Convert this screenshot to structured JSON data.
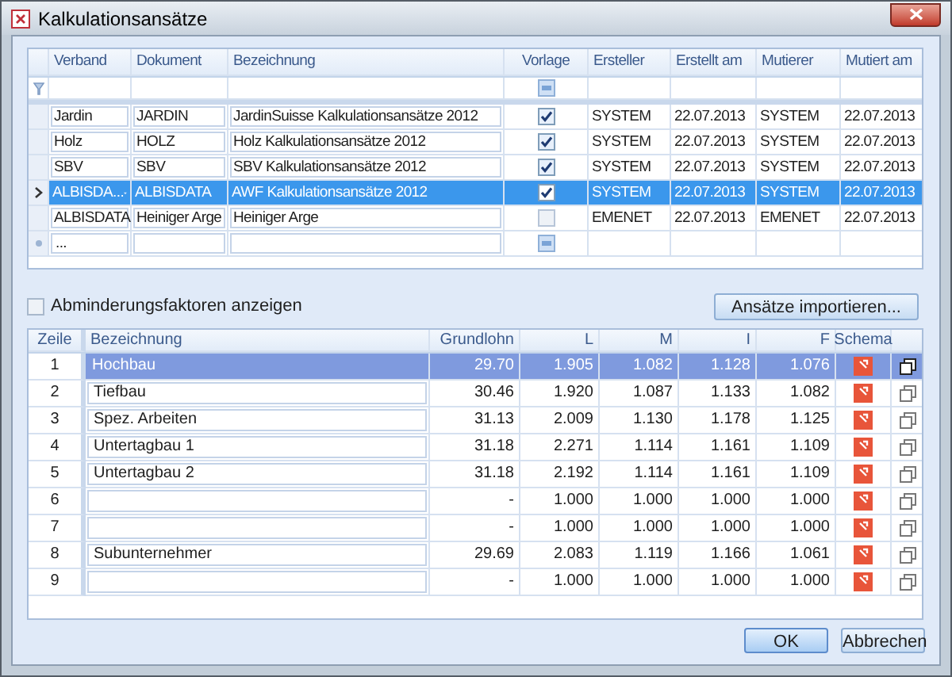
{
  "window": {
    "title": "Kalkulationsansätze"
  },
  "top_grid": {
    "columns": [
      "Verband",
      "Dokument",
      "Bezeichnung",
      "Vorlage",
      "Ersteller",
      "Erstellt am",
      "Mutierer",
      "Mutiert am"
    ],
    "rows": [
      {
        "verband": "Jardin",
        "dokument": "JARDIN",
        "bezeichnung": "JardinSuisse Kalkulationsansätze 2012",
        "vorlage": true,
        "ersteller": "SYSTEM",
        "erstellt_am": "22.07.2013",
        "mutierer": "SYSTEM",
        "mutiert_am": "22.07.2013",
        "selected": false
      },
      {
        "verband": "Holz",
        "dokument": "HOLZ",
        "bezeichnung": "Holz Kalkulationsansätze 2012",
        "vorlage": true,
        "ersteller": "SYSTEM",
        "erstellt_am": "22.07.2013",
        "mutierer": "SYSTEM",
        "mutiert_am": "22.07.2013",
        "selected": false
      },
      {
        "verband": "SBV",
        "dokument": "SBV",
        "bezeichnung": "SBV Kalkulationsansätze 2012",
        "vorlage": true,
        "ersteller": "SYSTEM",
        "erstellt_am": "22.07.2013",
        "mutierer": "SYSTEM",
        "mutiert_am": "22.07.2013",
        "selected": false
      },
      {
        "verband": "ALBISDA...",
        "dokument": "ALBISDATA",
        "bezeichnung": "AWF Kalkulationsansätze 2012",
        "vorlage": true,
        "ersteller": "SYSTEM",
        "erstellt_am": "22.07.2013",
        "mutierer": "SYSTEM",
        "mutiert_am": "22.07.2013",
        "selected": true
      },
      {
        "verband": "ALBISDATA",
        "dokument": "Heiniger Arge",
        "bezeichnung": "Heiniger Arge",
        "vorlage": false,
        "ersteller": "EMENET",
        "erstellt_am": "22.07.2013",
        "mutierer": "EMENET",
        "mutiert_am": "22.07.2013",
        "selected": false
      }
    ],
    "new_row": {
      "verband": "..."
    }
  },
  "show_factors": {
    "label": "Abminderungsfaktoren anzeigen",
    "checked": false
  },
  "import_button": "Ansätze importieren...",
  "bottom_grid": {
    "columns": [
      "Zeile",
      "Bezeichnung",
      "Grundlohn",
      "L",
      "M",
      "I",
      "F",
      "Schema"
    ],
    "rows": [
      {
        "zeile": "1",
        "bezeichnung": "Hochbau",
        "grundlohn": "29.70",
        "l": "1.905",
        "m": "1.082",
        "i": "1.128",
        "f": "1.076",
        "selected": true
      },
      {
        "zeile": "2",
        "bezeichnung": "Tiefbau",
        "grundlohn": "30.46",
        "l": "1.920",
        "m": "1.087",
        "i": "1.133",
        "f": "1.082",
        "selected": false
      },
      {
        "zeile": "3",
        "bezeichnung": "Spez. Arbeiten",
        "grundlohn": "31.13",
        "l": "2.009",
        "m": "1.130",
        "i": "1.178",
        "f": "1.125",
        "selected": false
      },
      {
        "zeile": "4",
        "bezeichnung": "Untertagbau 1",
        "grundlohn": "31.18",
        "l": "2.271",
        "m": "1.114",
        "i": "1.161",
        "f": "1.109",
        "selected": false
      },
      {
        "zeile": "5",
        "bezeichnung": "Untertagbau 2",
        "grundlohn": "31.18",
        "l": "2.192",
        "m": "1.114",
        "i": "1.161",
        "f": "1.109",
        "selected": false
      },
      {
        "zeile": "6",
        "grundlohn": "-",
        "l": "1.000",
        "m": "1.000",
        "i": "1.000",
        "f": "1.000",
        "selected": false
      },
      {
        "zeile": "7",
        "grundlohn": "-",
        "l": "1.000",
        "m": "1.000",
        "i": "1.000",
        "f": "1.000",
        "selected": false
      },
      {
        "zeile": "8",
        "bezeichnung": "Subunternehmer",
        "grundlohn": "29.69",
        "l": "2.083",
        "m": "1.119",
        "i": "1.166",
        "f": "1.061",
        "selected": false
      },
      {
        "zeile": "9",
        "grundlohn": "-",
        "l": "1.000",
        "m": "1.000",
        "i": "1.000",
        "f": "1.000",
        "selected": false
      }
    ]
  },
  "buttons": [
    "OK",
    "Abbrechen"
  ]
}
